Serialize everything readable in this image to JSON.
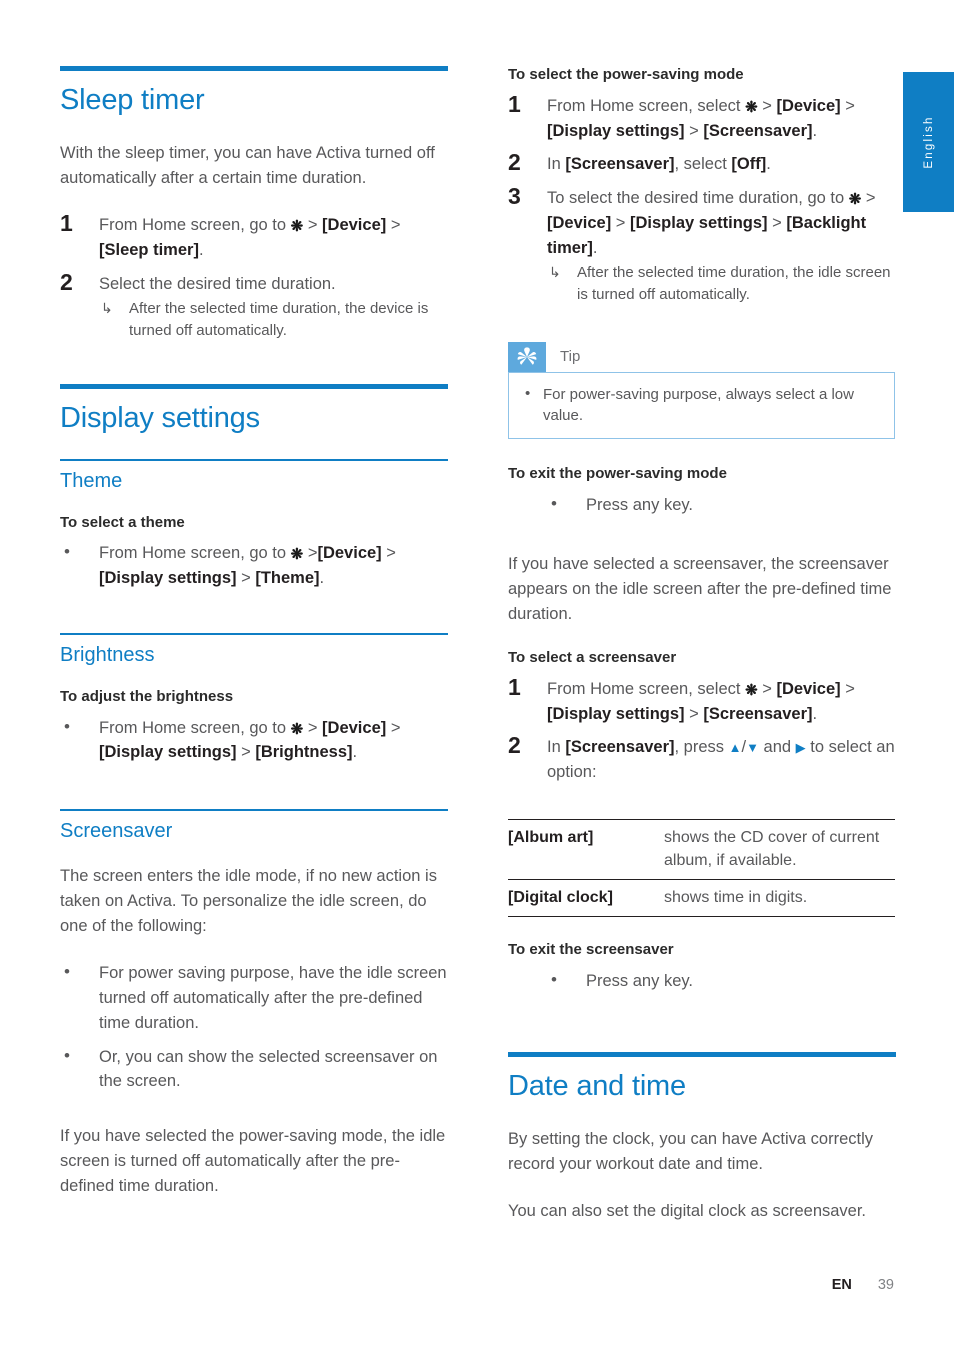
{
  "page": {
    "language_tab": "English",
    "footer": {
      "locale": "EN",
      "page_number": "39"
    },
    "accent_color": "#0f7ec4",
    "tip_icon_color": "#5ea9dd"
  },
  "left_column": {
    "section1": {
      "title": "Sleep timer",
      "intro": "With the sleep timer, you can have Activa turned off automatically after a certain time duration.",
      "steps": [
        {
          "num": "1",
          "prefix": "From Home screen, go to ",
          "icon": "gear-icon",
          "path": [
            "[Device]",
            "[Sleep timer]"
          ],
          "suffix": "."
        },
        {
          "num": "2",
          "text": "Select the desired time duration.",
          "result": "After the selected time duration, the device is turned off automatically."
        }
      ]
    },
    "section2": {
      "title": "Display settings",
      "subsections": [
        {
          "title": "Theme",
          "procedure_title": "To select a theme",
          "bullet": {
            "prefix": "From Home screen, go to ",
            "icon": "gear-icon",
            "path": [
              "[Device]",
              "[Display settings]",
              "[Theme]"
            ],
            "suffix": "."
          }
        },
        {
          "title": "Brightness",
          "procedure_title": "To adjust the brightness",
          "bullet": {
            "prefix": "From Home screen, go to ",
            "icon": "gear-icon",
            "path": [
              "[Device]",
              "[Display settings]",
              "[Brightness]"
            ],
            "suffix": "."
          }
        },
        {
          "title": "Screensaver",
          "intro": "The screen enters the idle mode, if no new action is taken on Activa. To personalize the idle screen, do one of the following:",
          "bullets": [
            "For power saving purpose, have the idle screen turned off automatically after the pre-defined time duration.",
            "Or, you can show the selected screensaver on the screen."
          ],
          "outro": "If you have selected the power-saving mode, the idle screen is turned off automatically after the pre-defined time duration."
        }
      ]
    }
  },
  "right_column": {
    "power_saving_select": {
      "procedure_title": "To select the power-saving mode",
      "steps": [
        {
          "num": "1",
          "prefix": "From Home screen, select ",
          "icon": "gear-icon",
          "path": [
            "[Device]",
            "[Display settings]",
            "[Screensaver]"
          ],
          "suffix": "."
        },
        {
          "num": "2",
          "prefix": "In ",
          "target": "[Screensaver]",
          "middle": ", select ",
          "value": "[Off]",
          "suffix": "."
        },
        {
          "num": "3",
          "lead": "To select the desired time duration, go to ",
          "icon": "gear-icon",
          "path": [
            "[Device]",
            "[Display settings]",
            "[Backlight timer]"
          ],
          "suffix": ".",
          "result": "After the selected time duration, the idle screen is turned off automatically."
        }
      ]
    },
    "tip": {
      "label": "Tip",
      "icon": "asterisk-icon",
      "items": [
        "For power-saving purpose, always select a low value."
      ]
    },
    "power_saving_exit": {
      "procedure_title": "To exit the power-saving mode",
      "bullet": "Press any key.",
      "paragraph": "If you have selected a screensaver, the screensaver appears on the idle screen after the pre-defined time duration."
    },
    "screensaver_select": {
      "procedure_title": "To select a screensaver",
      "steps": [
        {
          "num": "1",
          "prefix": "From Home screen, select ",
          "icon": "gear-icon",
          "path": [
            "[Device]",
            "[Display settings]",
            "[Screensaver]"
          ],
          "suffix": "."
        },
        {
          "num": "2",
          "prefix": "In ",
          "target": "[Screensaver]",
          "middle": ", press ",
          "keys": [
            "up-arrow-icon",
            "down-arrow-icon",
            "right-arrow-icon"
          ],
          "middle2": " and ",
          "suffix": " to select an option:"
        }
      ],
      "options": [
        {
          "term": "[Album art]",
          "desc": "shows the CD cover of current album, if available."
        },
        {
          "term": "[Digital clock]",
          "desc": "shows time in digits."
        }
      ]
    },
    "screensaver_exit": {
      "procedure_title": "To exit the screensaver",
      "bullet": "Press any key."
    },
    "date_and_time": {
      "title": "Date and time",
      "paragraph1": "By setting the clock, you can have Activa correctly record your workout date and time.",
      "paragraph2": "You can also set the digital clock as screensaver."
    }
  }
}
